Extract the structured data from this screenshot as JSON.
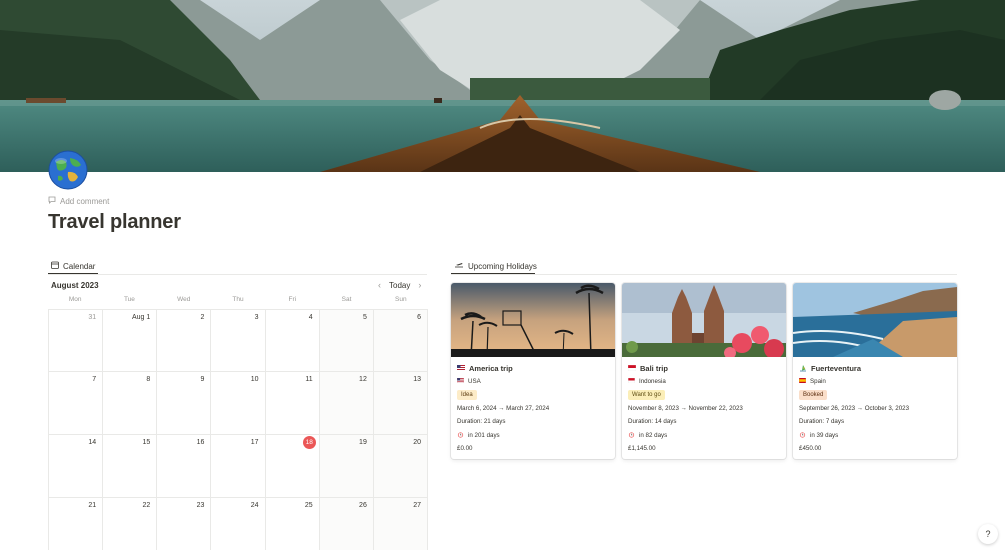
{
  "page": {
    "add_comment": "Add comment",
    "title": "Travel planner"
  },
  "calendar": {
    "tab_label": "Calendar",
    "month": "August 2023",
    "today_label": "Today",
    "weekdays": [
      "Mon",
      "Tue",
      "Wed",
      "Thu",
      "Fri",
      "Sat",
      "Sun"
    ],
    "weeks": [
      [
        "31",
        "Aug 1",
        "2",
        "3",
        "4",
        "5",
        "6"
      ],
      [
        "7",
        "8",
        "9",
        "10",
        "11",
        "12",
        "13"
      ],
      [
        "14",
        "15",
        "16",
        "17",
        "18",
        "19",
        "20"
      ],
      [
        "21",
        "22",
        "23",
        "24",
        "25",
        "26",
        "27"
      ]
    ],
    "today_day": "18"
  },
  "holidays": {
    "tab_label": "Upcoming Holidays",
    "cards": [
      {
        "title": "America trip",
        "country": "USA",
        "status": "Idea",
        "dates": "March 6, 2024 → March 27, 2024",
        "duration": "Duration: 21 days",
        "countdown": "in 201 days",
        "budget": "£0.00"
      },
      {
        "title": "Bali trip",
        "country": "Indonesia",
        "status": "Want to go",
        "dates": "November 8, 2023 → November 22, 2023",
        "duration": "Duration: 14 days",
        "countdown": "in 82 days",
        "budget": "£1,145.00"
      },
      {
        "title": "Fuerteventura",
        "country": "Spain",
        "status": "Booked",
        "dates": "September 26, 2023 → October 3, 2023",
        "duration": "Duration: 7 days",
        "countdown": "in 39 days",
        "budget": "£450.00"
      }
    ]
  },
  "help_label": "?",
  "colors": {
    "today_badge": "#eb5757",
    "tag_idea": "#fdecc8",
    "tag_want_to_go": "#fbeeb8",
    "tag_booked": "#fadec9",
    "text": "#37352f",
    "muted": "#9b9a97"
  }
}
